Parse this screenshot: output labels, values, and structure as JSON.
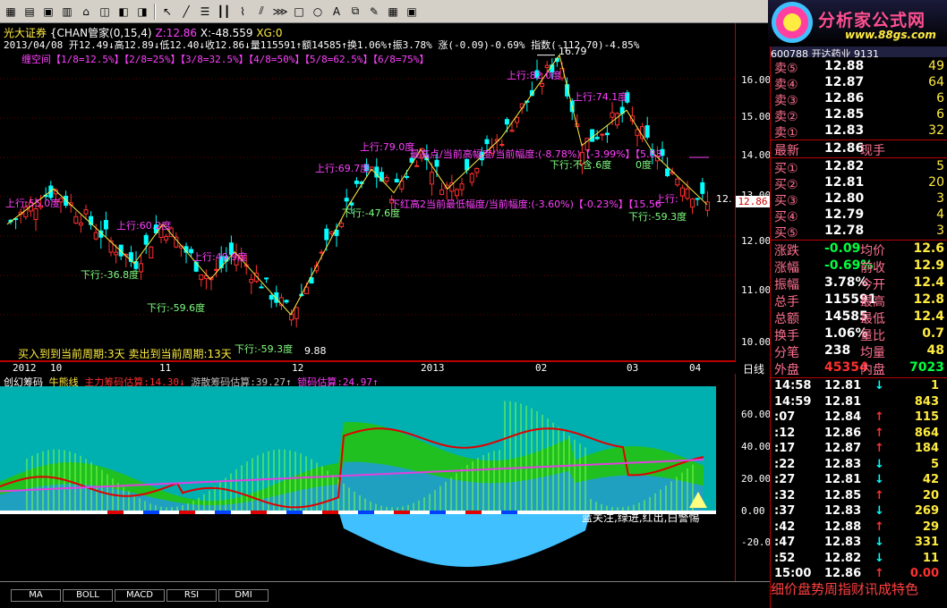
{
  "logo": {
    "title": "分析家公式网",
    "url": "www.88gs.com"
  },
  "toolbar": {
    "icons": [
      "cursor-icon",
      "line-icon",
      "hline-icon",
      "vlines-icon",
      "fan-icon",
      "channel-icon",
      "gann-icon",
      "rect-icon",
      "ellipse-icon",
      "text-icon",
      "copy-icon",
      "eraser-icon",
      "color-icon",
      "save-icon"
    ]
  },
  "header": {
    "broker": "光大证券",
    "indicator": "{CHAN管家(0,15,4)",
    "z": "Z:12.86",
    "x": "X:-48.559",
    "xg": "XG:0",
    "quote": "2013/04/08 开12.49↓高12.89↓低12.40↓收12.86↓量115591↑额14585↑换1.06%↑振3.78% 涨(-0.09)-0.69% 指数(-112.70)-4.85%",
    "levels": "缠空间【1/8=12.5%】【2/8=25%】【3/8=32.5%】【4/8=50%】【5/8=62.5%】【6/8=75%】"
  },
  "price_axis": [
    "16.00",
    "15.00",
    "14.00",
    "13.00",
    "12.00",
    "11.00",
    "10.00"
  ],
  "current_price_tag": "12.86",
  "cycle_text": "买入到到当前周期:3天  卖出到当前周期:13天",
  "date_axis": [
    "2012",
    "10",
    "11",
    "12",
    "2013",
    "02",
    "03",
    "04"
  ],
  "period_label": "日线",
  "annotations": [
    "上行:55.0度",
    "上行:60.2度",
    "上行:49.9度",
    "上行:69.7度",
    "上行:79.0度",
    "上行:82.0度",
    "上行:74.1度",
    "上行:",
    "下行:-36.8度",
    "下行:-59.6度",
    "下行:-59.3度",
    "下行:-47.6度",
    "下行:-59.3度",
    "下行:不含.6度",
    "16.79",
    "9.88",
    "0度",
    "最高点/当前高幅度/当前幅度:(-8.78%)【-3.99%】【5.83",
    "下红高2当前最低幅度/当前幅度:(-3.60%)【-0.23%】【15.56",
    "12."
  ],
  "sub": {
    "name": "创幻筹码",
    "s1": "牛熊线",
    "s2": "主力筹码估算:14.30↓",
    "s3": "游散筹码估算:39.27↑",
    "s4": "锁码估算:24.97↑",
    "axis": [
      "60.00",
      "40.00",
      "20.00",
      "0.00",
      "-20.00"
    ],
    "legend": "蓝关注,绿进,红出,白警惕"
  },
  "tabs": [
    "MA",
    "BOLL",
    "MACD",
    "RSI",
    "DMI"
  ],
  "stock_header": "600788 开达药业 9131",
  "order_book": {
    "sells": [
      {
        "label": "卖⑤",
        "price": "12.88",
        "vol": "49"
      },
      {
        "label": "卖④",
        "price": "12.87",
        "vol": "64"
      },
      {
        "label": "卖③",
        "price": "12.86",
        "vol": "6"
      },
      {
        "label": "卖②",
        "price": "12.85",
        "vol": "6"
      },
      {
        "label": "卖①",
        "price": "12.83",
        "vol": "32"
      }
    ],
    "latest": {
      "label": "最新",
      "price": "12.86",
      "tag": "现手"
    },
    "buys": [
      {
        "label": "买①",
        "price": "12.82",
        "vol": "5"
      },
      {
        "label": "买②",
        "price": "12.81",
        "vol": "20"
      },
      {
        "label": "买③",
        "price": "12.80",
        "vol": "3"
      },
      {
        "label": "买④",
        "price": "12.79",
        "vol": "4"
      },
      {
        "label": "买⑤",
        "price": "12.78",
        "vol": "3"
      }
    ]
  },
  "quote_stats": [
    {
      "a": "涨跌",
      "b": "-0.09",
      "c": "均价",
      "d": "12.6"
    },
    {
      "a": "涨幅",
      "b": "-0.69%",
      "c": "前收",
      "d": "12.9"
    },
    {
      "a": "振幅",
      "b": "3.78%",
      "c": "今开",
      "d": "12.4"
    },
    {
      "a": "总手",
      "b": "115591",
      "c": "最高",
      "d": "12.8"
    },
    {
      "a": "总额",
      "b": "14585",
      "c": "最低",
      "d": "12.4"
    },
    {
      "a": "换手",
      "b": "1.06%",
      "c": "量比",
      "d": "0.7"
    },
    {
      "a": "分笔",
      "b": "238",
      "c": "均量",
      "d": "48"
    }
  ],
  "outer_inner": {
    "out_label": "外盘",
    "out": "45354",
    "in_label": "内盘",
    "in": "7023"
  },
  "ticks": [
    {
      "t": "14:58",
      "p": "12.81",
      "dir": "↓",
      "v": "1"
    },
    {
      "t": "14:59",
      "p": "12.81",
      "dir": "",
      "v": "843"
    },
    {
      "t": ":07",
      "p": "12.84",
      "dir": "↑",
      "v": "115"
    },
    {
      "t": ":12",
      "p": "12.86",
      "dir": "↑",
      "v": "864"
    },
    {
      "t": ":17",
      "p": "12.87",
      "dir": "↑",
      "v": "184"
    },
    {
      "t": ":22",
      "p": "12.83",
      "dir": "↓",
      "v": "5"
    },
    {
      "t": ":27",
      "p": "12.81",
      "dir": "↓",
      "v": "42"
    },
    {
      "t": ":32",
      "p": "12.85",
      "dir": "↑",
      "v": "20"
    },
    {
      "t": ":37",
      "p": "12.83",
      "dir": "↓",
      "v": "269"
    },
    {
      "t": ":42",
      "p": "12.88",
      "dir": "↑",
      "v": "29"
    },
    {
      "t": ":47",
      "p": "12.83",
      "dir": "↓",
      "v": "331"
    },
    {
      "t": ":52",
      "p": "12.82",
      "dir": "↓",
      "v": "11"
    },
    {
      "t": "15:00",
      "p": "12.86",
      "dir": "↑",
      "v": "0.00"
    }
  ],
  "ticker": "细价盘势周指财讯成特色",
  "colors": {
    "up": "#ff3030",
    "down": "#00ffff",
    "bull": "#ffec40",
    "panel": "#d4d0c8"
  }
}
